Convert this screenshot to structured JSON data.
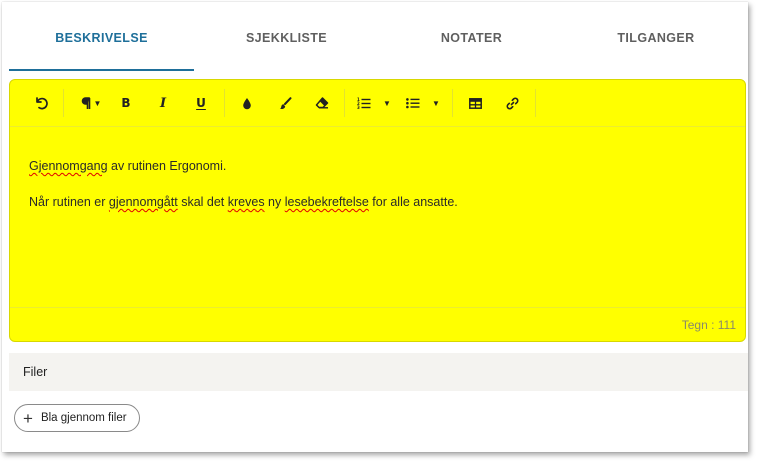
{
  "tabs": [
    {
      "label": "BESKRIVELSE",
      "active": true
    },
    {
      "label": "SJEKKLISTE",
      "active": false
    },
    {
      "label": "NOTATER",
      "active": false
    },
    {
      "label": "TILGANGER",
      "active": false
    }
  ],
  "colors": {
    "accent": "#1e6f9a",
    "editor_background": "#ffff00",
    "files_header_background": "#f4f3f0"
  },
  "toolbar": {
    "buttons": [
      {
        "name": "undo",
        "icon": "undo-icon"
      },
      {
        "name": "paragraph-style",
        "icon": "pilcrow-icon"
      },
      {
        "name": "bold",
        "icon": "bold-icon",
        "glyph": "B"
      },
      {
        "name": "italic",
        "icon": "italic-icon",
        "glyph": "I"
      },
      {
        "name": "underline",
        "icon": "underline-icon",
        "glyph": "U"
      },
      {
        "name": "text-color",
        "icon": "droplet-icon"
      },
      {
        "name": "brush",
        "icon": "brush-icon"
      },
      {
        "name": "clear-format",
        "icon": "eraser-icon"
      },
      {
        "name": "ordered-list",
        "icon": "ordered-list-icon"
      },
      {
        "name": "unordered-list",
        "icon": "unordered-list-icon"
      },
      {
        "name": "table",
        "icon": "table-icon"
      },
      {
        "name": "link",
        "icon": "link-icon"
      }
    ]
  },
  "editor": {
    "paragraph1": {
      "word1": "Gjennomgang",
      "rest": " av rutinen Ergonomi."
    },
    "paragraph2": {
      "t1": "Når rutinen er ",
      "w1": "gjennomgått",
      "t2": " skal det ",
      "w2": "kreves",
      "t3": " ny ",
      "w3": "lesebekreftelse",
      "t4": " for alle ansatte."
    },
    "char_count": "Tegn : 111"
  },
  "files": {
    "header": "Filer",
    "browse_label": "Bla gjennom filer"
  }
}
